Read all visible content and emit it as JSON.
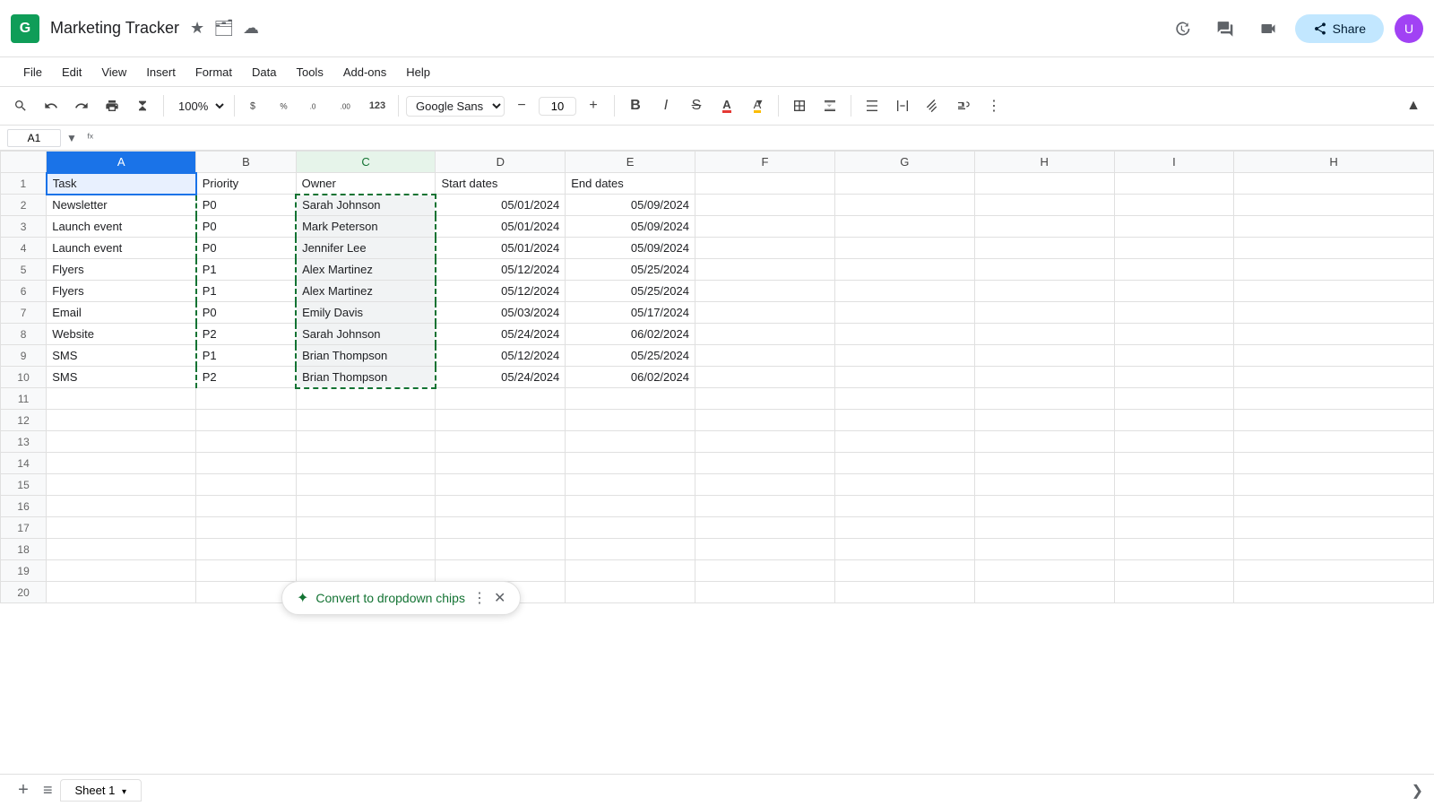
{
  "app": {
    "icon": "G",
    "title": "Marketing Tracker",
    "icons": [
      "★",
      "🗂",
      "☁"
    ]
  },
  "topbar": {
    "history_label": "⟲",
    "comment_label": "💬",
    "video_label": "📷",
    "share_label": "Share",
    "avatar_label": "U"
  },
  "menubar": {
    "items": [
      "File",
      "Edit",
      "View",
      "Insert",
      "Format",
      "Data",
      "Tools",
      "Add-ons",
      "Help"
    ]
  },
  "toolbar": {
    "zoom": "100%",
    "font": "Googl...",
    "font_size": "10"
  },
  "formula_bar": {
    "cell_ref": "A1",
    "formula": ""
  },
  "sheet": {
    "col_headers": [
      "",
      "A",
      "B",
      "C",
      "D",
      "E",
      "F",
      "G",
      "H",
      "I",
      "H"
    ],
    "rows": [
      {
        "row": 1,
        "a": "Task",
        "b": "Priority",
        "c": "Owner",
        "d": "Start dates",
        "e": "End dates"
      },
      {
        "row": 2,
        "a": "Newsletter",
        "b": "P0",
        "c": "Sarah Johnson",
        "d": "05/01/2024",
        "e": "05/09/2024"
      },
      {
        "row": 3,
        "a": "Launch event",
        "b": "P0",
        "c": "Mark Peterson",
        "d": "05/01/2024",
        "e": "05/09/2024"
      },
      {
        "row": 4,
        "a": "Launch event",
        "b": "P0",
        "c": "Jennifer Lee",
        "d": "05/01/2024",
        "e": "05/09/2024"
      },
      {
        "row": 5,
        "a": "Flyers",
        "b": "P1",
        "c": "Alex Martinez",
        "d": "05/12/2024",
        "e": "05/25/2024"
      },
      {
        "row": 6,
        "a": "Flyers",
        "b": "P1",
        "c": "Alex Martinez",
        "d": "05/12/2024",
        "e": "05/25/2024"
      },
      {
        "row": 7,
        "a": "Email",
        "b": "P0",
        "c": "Emily Davis",
        "d": "05/03/2024",
        "e": "05/17/2024"
      },
      {
        "row": 8,
        "a": "Website",
        "b": "P2",
        "c": "Sarah Johnson",
        "d": "05/24/2024",
        "e": "06/02/2024"
      },
      {
        "row": 9,
        "a": "SMS",
        "b": "P1",
        "c": "Brian Thompson",
        "d": "05/12/2024",
        "e": "05/25/2024"
      },
      {
        "row": 10,
        "a": "SMS",
        "b": "P2",
        "c": "Brian Thompson",
        "d": "05/24/2024",
        "e": "06/02/2024"
      },
      {
        "row": 11,
        "a": "",
        "b": "",
        "c": "",
        "d": "",
        "e": ""
      },
      {
        "row": 12,
        "a": "",
        "b": "",
        "c": "",
        "d": "",
        "e": ""
      },
      {
        "row": 13,
        "a": "",
        "b": "",
        "c": "",
        "d": "",
        "e": ""
      },
      {
        "row": 14,
        "a": "",
        "b": "",
        "c": "",
        "d": "",
        "e": ""
      },
      {
        "row": 15,
        "a": "",
        "b": "",
        "c": "",
        "d": "",
        "e": ""
      },
      {
        "row": 16,
        "a": "",
        "b": "",
        "c": "",
        "d": "",
        "e": ""
      },
      {
        "row": 17,
        "a": "",
        "b": "",
        "c": "",
        "d": "",
        "e": ""
      },
      {
        "row": 18,
        "a": "",
        "b": "",
        "c": "",
        "d": "",
        "e": ""
      },
      {
        "row": 19,
        "a": "",
        "b": "",
        "c": "",
        "d": "",
        "e": ""
      },
      {
        "row": 20,
        "a": "",
        "b": "",
        "c": "",
        "d": "",
        "e": ""
      }
    ]
  },
  "chip_popup": {
    "icon": "✦",
    "text": "Convert to dropdown chips",
    "dots": "⋮",
    "close": "✕"
  },
  "bottom": {
    "add_sheet": "+",
    "sheets_menu": "≡",
    "sheet_name": "Sheet 1",
    "sheet_arrow": "▾",
    "right_arrow": "❯"
  }
}
